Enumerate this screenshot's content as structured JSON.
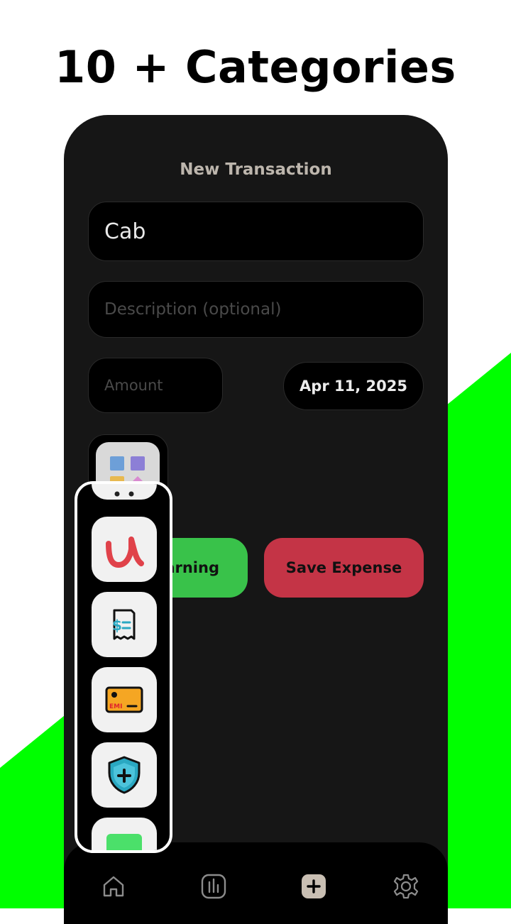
{
  "headline": "10 + Categories",
  "colors": {
    "accent_green": "#00ff00",
    "phone_bg": "#161616",
    "earning_green": "#39c24a",
    "expense_red": "#c43446"
  },
  "screen": {
    "title": "New Transaction",
    "name_value": "Cab",
    "description_placeholder": "Description (optional)",
    "amount_placeholder": "Amount",
    "date": "Apr 11, 2025",
    "earning_label_visible": "arning",
    "save_expense_label": "Save Expense"
  },
  "category_picker": {
    "items": [
      {
        "icon": "udemy-icon"
      },
      {
        "icon": "bill-receipt-icon"
      },
      {
        "icon": "emi-card-icon"
      },
      {
        "icon": "insurance-shield-icon"
      }
    ]
  },
  "bottom_nav": {
    "items": [
      {
        "icon": "home-icon"
      },
      {
        "icon": "stats-icon"
      },
      {
        "icon": "add-icon"
      },
      {
        "icon": "settings-icon"
      }
    ]
  }
}
